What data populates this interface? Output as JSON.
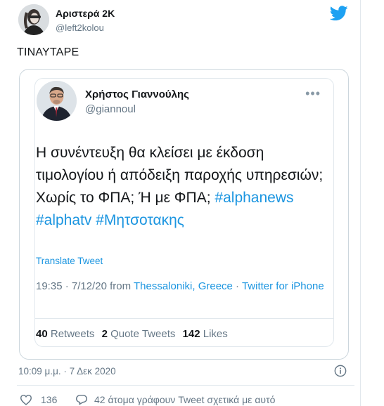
{
  "embed": {
    "author_name": "Αριστερά 2Κ",
    "author_handle": "@left2kolou",
    "text": "TINAYTAPE",
    "timestamp": "10:09 μ.μ. · 7 Δεκ 2020",
    "likes_count": "136",
    "talking_text": "42 άτομα γράφουν Tweet σχετικά με αυτό"
  },
  "quoted": {
    "author_name": "Χρήστος Γιαννούλης",
    "author_handle": "@giannoul",
    "more_label": "•••",
    "body_text": "Η συνέντευξη θα κλείσει με έκδοση τιμολογίου ή απόδειξη παροχής υπηρεσιών; Χωρίς το ΦΠΑ; Ή με ΦΠΑ;",
    "hashtags": [
      "#alphanews",
      "#alphatv",
      "#Μητσοτακης"
    ],
    "translate_label": "Translate Tweet",
    "time": "19:35 · 7/12/20 from ",
    "location": "Thessaloniki, Greece",
    "source": "Twitter for iPhone",
    "retweets_count": "40",
    "retweets_label": "Retweets",
    "quote_tweets_count": "2",
    "quote_tweets_label": "Quote Tweets",
    "likes_count": "142",
    "likes_label": "Likes"
  },
  "colors": {
    "twitter_blue": "#1da1f2",
    "link_blue": "#1b95e0",
    "muted_gray": "#657786",
    "border": "#e1e8ed"
  },
  "icons": [
    "twitter-bird-icon",
    "more-icon",
    "info-icon",
    "heart-icon",
    "reply-bubble-icon"
  ]
}
